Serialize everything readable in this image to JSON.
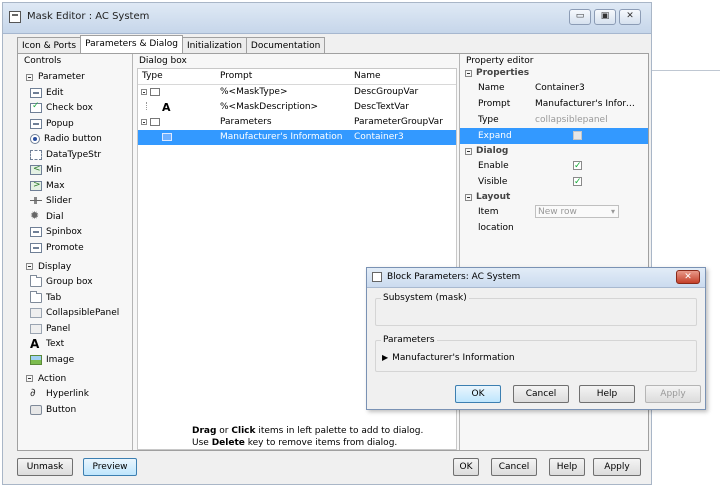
{
  "main_window": {
    "title": "Mask Editor : AC System",
    "window_buttons": [
      "▭",
      "▣",
      "✕"
    ],
    "tabs": [
      {
        "label": "Icon & Ports"
      },
      {
        "label": "Parameters & Dialog"
      },
      {
        "label": "Initialization"
      },
      {
        "label": "Documentation"
      }
    ]
  },
  "controls": {
    "header": "Controls",
    "groups": [
      {
        "title": "Parameter",
        "items": [
          "Edit",
          "Check box",
          "Popup",
          "Radio button",
          "DataTypeStr",
          "Min",
          "Max",
          "Slider",
          "Dial",
          "Spinbox",
          "Promote"
        ]
      },
      {
        "title": "Display",
        "items": [
          "Group box",
          "Tab",
          "CollapsiblePanel",
          "Panel",
          "Text",
          "Image"
        ]
      },
      {
        "title": "Action",
        "items": [
          "Hyperlink",
          "Button"
        ]
      }
    ]
  },
  "dialog_box": {
    "header": "Dialog box",
    "columns": [
      "Type",
      "Prompt",
      "Name"
    ],
    "rows": [
      {
        "prompt": "%<MaskType>",
        "name": "DescGroupVar"
      },
      {
        "prompt": "%<MaskDescription>",
        "name": "DescTextVar"
      },
      {
        "prompt": "Parameters",
        "name": "ParameterGroupVar"
      },
      {
        "prompt": "Manufacturer's Information",
        "name": "Container3"
      }
    ],
    "hint_line1_a": "Drag",
    "hint_line1_b": " or ",
    "hint_line1_c": "Click",
    "hint_line1_d": " items in left palette to add to dialog.",
    "hint_line2_a": "Use ",
    "hint_line2_b": "Delete",
    "hint_line2_c": " key to remove items from dialog."
  },
  "property_editor": {
    "header": "Property editor",
    "properties_label": "Properties",
    "name_label": "Name",
    "name_value": "Container3",
    "prompt_label": "Prompt",
    "prompt_value": "Manufacturer's Information",
    "type_label": "Type",
    "type_value": "collapsiblepanel",
    "expand_label": "Expand",
    "expand_checked": false,
    "dialog_label": "Dialog",
    "enable_label": "Enable",
    "enable_checked": true,
    "visible_label": "Visible",
    "visible_checked": true,
    "layout_label": "Layout",
    "item_location_label": "Item location",
    "item_location_value": "New row"
  },
  "main_buttons": {
    "unmask": "Unmask",
    "preview": "Preview",
    "ok": "OK",
    "cancel": "Cancel",
    "help": "Help",
    "apply": "Apply"
  },
  "block_params": {
    "title": "Block Parameters: AC System",
    "close": "✕",
    "subsystem_legend": "Subsystem (mask)",
    "parameters_legend": "Parameters",
    "expander_label": "Manufacturer's Information",
    "ok": "OK",
    "cancel": "Cancel",
    "help": "Help",
    "apply": "Apply"
  }
}
